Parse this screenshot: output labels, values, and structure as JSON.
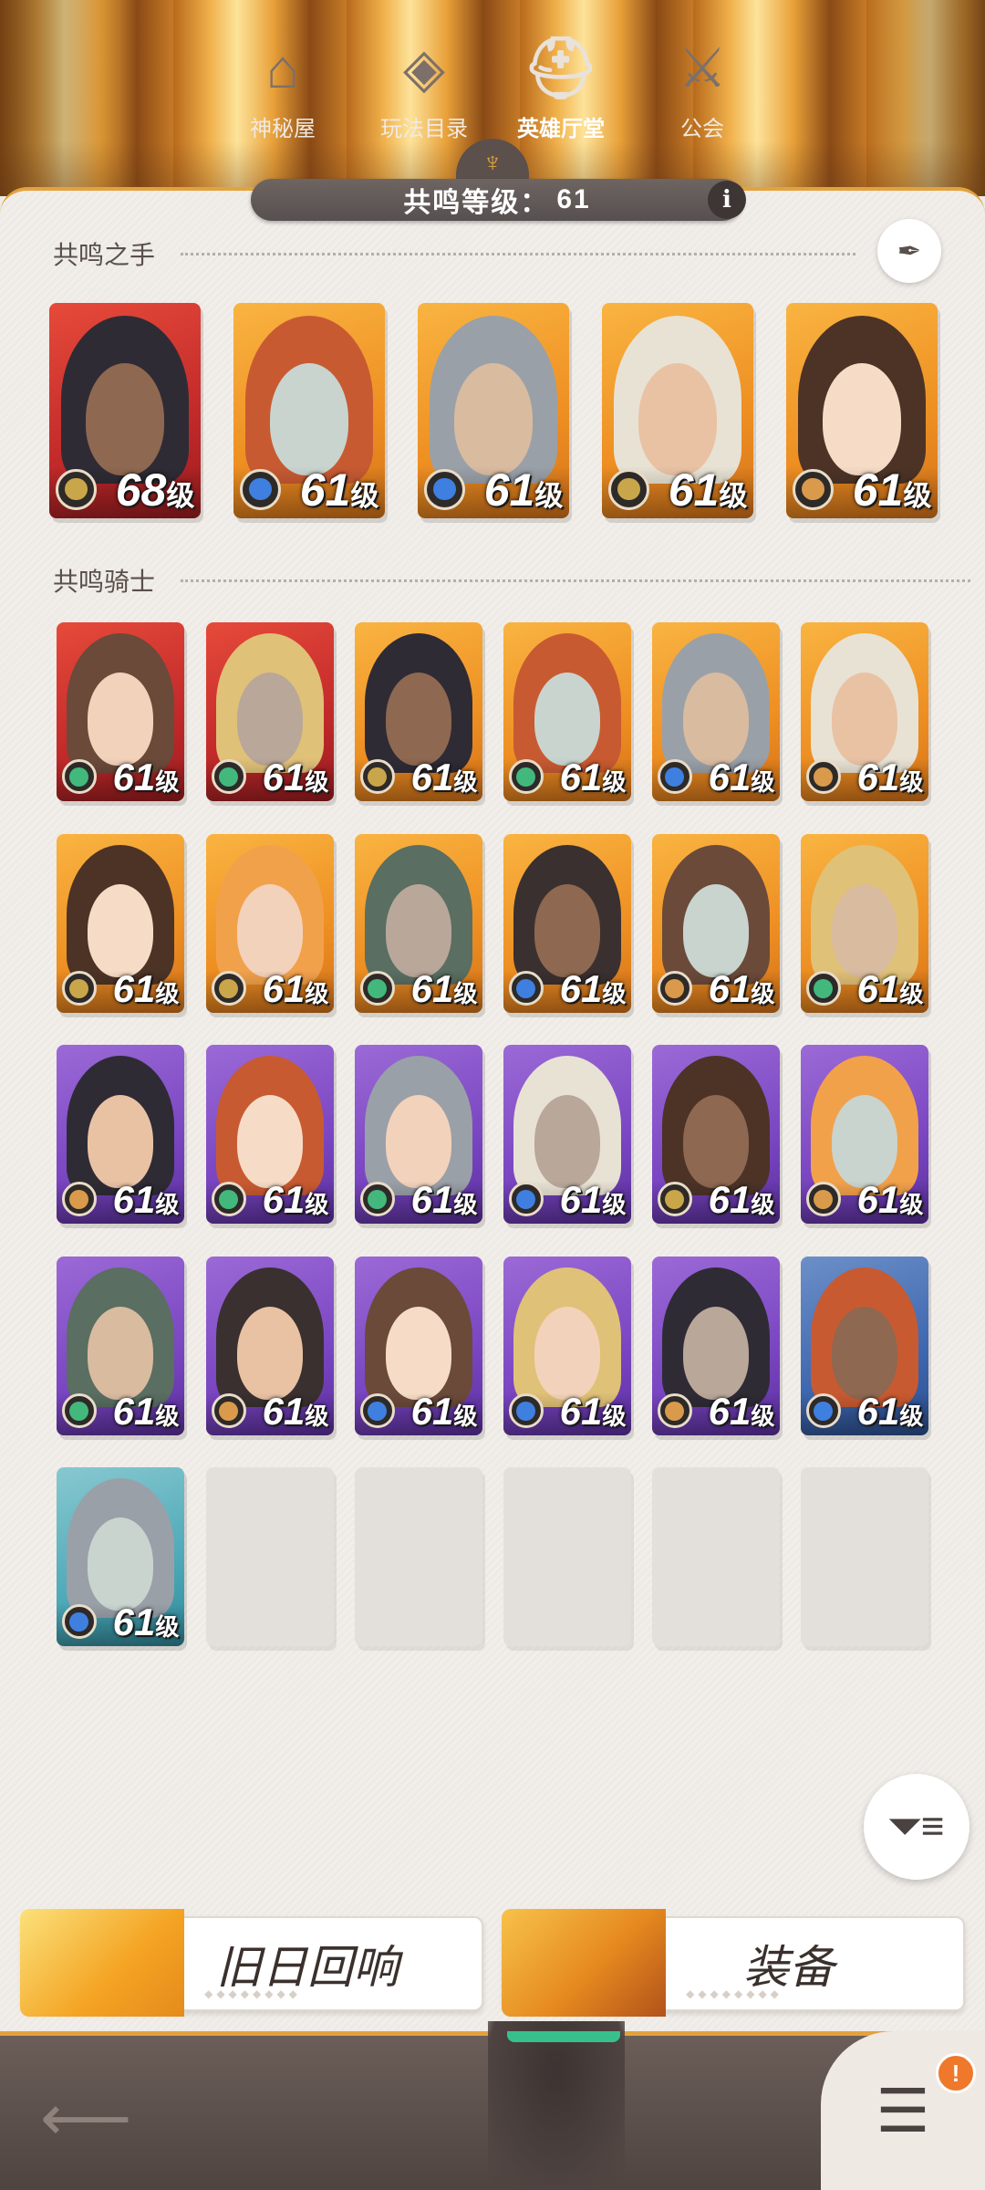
{
  "header": {
    "level_label": "共鸣等级：",
    "level_value": "61",
    "info_glyph": "i"
  },
  "sections": {
    "hands_title": "共鸣之手",
    "knights_title": "共鸣骑士"
  },
  "hands": [
    {
      "level": "68",
      "faction": "mauler",
      "bg": "red"
    },
    {
      "level": "61",
      "faction": "lightbearer",
      "bg": "orange"
    },
    {
      "level": "61",
      "faction": "lightbearer",
      "bg": "orange"
    },
    {
      "level": "61",
      "faction": "mauler",
      "bg": "orange"
    },
    {
      "level": "61",
      "faction": "graveborn",
      "bg": "orange"
    }
  ],
  "knights": [
    {
      "level": "61",
      "faction": "wilder",
      "bg": "red"
    },
    {
      "level": "61",
      "faction": "wilder",
      "bg": "red"
    },
    {
      "level": "61",
      "faction": "mauler",
      "bg": "orange"
    },
    {
      "level": "61",
      "faction": "wilder",
      "bg": "orange"
    },
    {
      "level": "61",
      "faction": "lightbearer",
      "bg": "orange"
    },
    {
      "level": "61",
      "faction": "graveborn",
      "bg": "orange"
    },
    {
      "level": "61",
      "faction": "mauler",
      "bg": "orange"
    },
    {
      "level": "61",
      "faction": "mauler",
      "bg": "orange"
    },
    {
      "level": "61",
      "faction": "wilder",
      "bg": "orange"
    },
    {
      "level": "61",
      "faction": "lightbearer",
      "bg": "orange"
    },
    {
      "level": "61",
      "faction": "graveborn",
      "bg": "orange"
    },
    {
      "level": "61",
      "faction": "wilder",
      "bg": "orange"
    },
    {
      "level": "61",
      "faction": "graveborn",
      "bg": "purple"
    },
    {
      "level": "61",
      "faction": "wilder",
      "bg": "purple"
    },
    {
      "level": "61",
      "faction": "wilder",
      "bg": "purple"
    },
    {
      "level": "61",
      "faction": "lightbearer",
      "bg": "purple"
    },
    {
      "level": "61",
      "faction": "mauler",
      "bg": "purple"
    },
    {
      "level": "61",
      "faction": "graveborn",
      "bg": "purple"
    },
    {
      "level": "61",
      "faction": "wilder",
      "bg": "purple"
    },
    {
      "level": "61",
      "faction": "graveborn",
      "bg": "purple"
    },
    {
      "level": "61",
      "faction": "lightbearer",
      "bg": "purple"
    },
    {
      "level": "61",
      "faction": "lightbearer",
      "bg": "purple"
    },
    {
      "level": "61",
      "faction": "graveborn",
      "bg": "purple"
    },
    {
      "level": "61",
      "faction": "lightbearer",
      "bg": "blue"
    },
    {
      "level": "61",
      "faction": "lightbearer",
      "bg": "teal"
    }
  ],
  "level_unit": "级",
  "buttons": {
    "echoes": "旧日回响",
    "equipment": "装备"
  },
  "nav": {
    "items": [
      "神秘屋",
      "玩法目录",
      "英雄厅堂",
      "公会"
    ],
    "badge": "!"
  },
  "colors": {
    "accent_gold": "#e3a23e",
    "active_green": "#38c08c",
    "nav_bg": "#5b4f4b"
  }
}
